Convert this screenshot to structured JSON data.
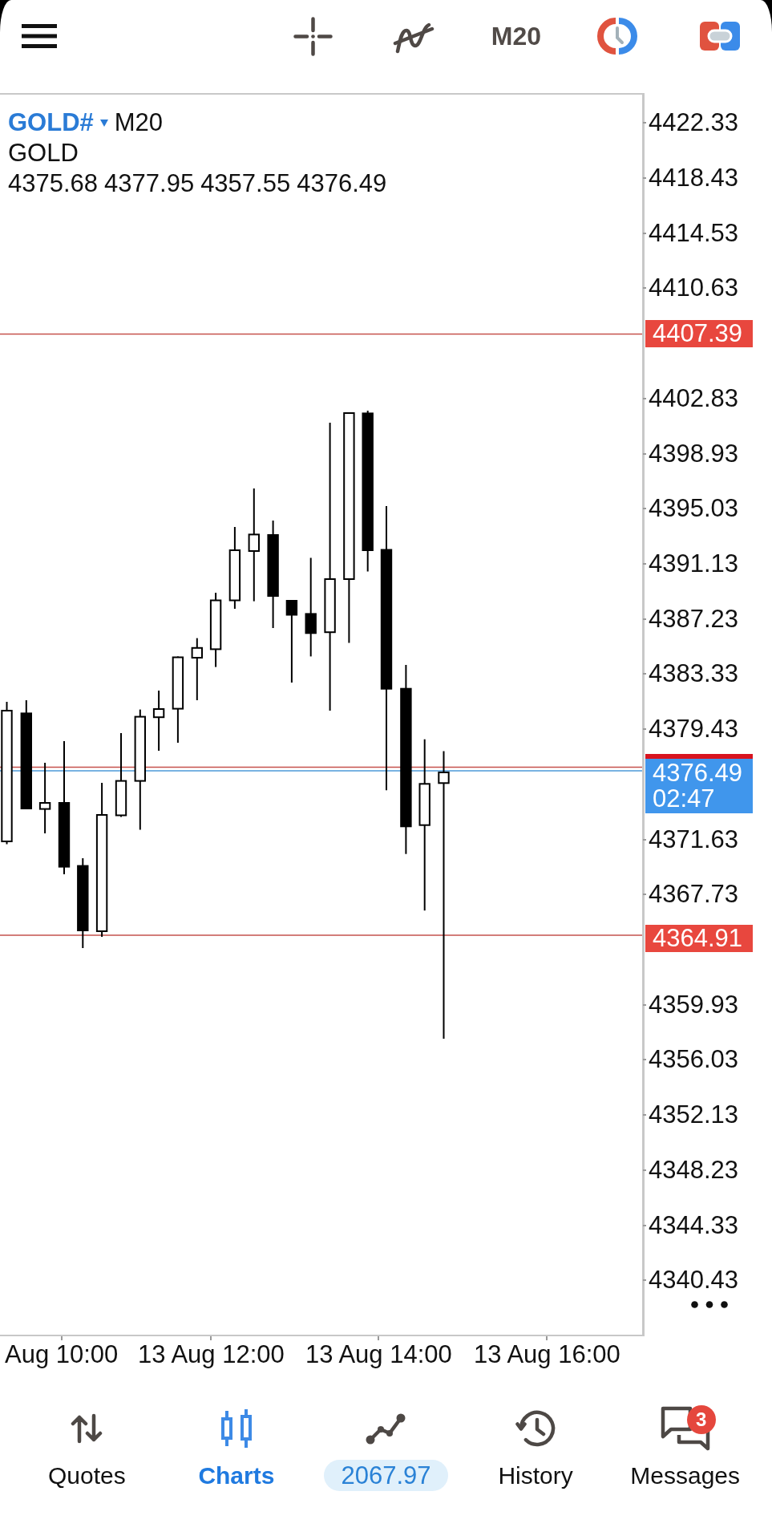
{
  "top_bar": {
    "timeframe": "M20"
  },
  "chart": {
    "symbol": "GOLD#",
    "timeframe": "M20",
    "description": "GOLD",
    "ohlc": [
      "4375.68",
      "4377.95",
      "4357.55",
      "4376.49"
    ],
    "price_ticks": [
      "4422.33",
      "4418.43",
      "4414.53",
      "4410.63",
      "4402.83",
      "4398.93",
      "4395.03",
      "4391.13",
      "4387.23",
      "4383.33",
      "4379.43",
      "4371.63",
      "4367.73",
      "4359.93",
      "4356.03",
      "4352.13",
      "4348.23",
      "4344.33",
      "4340.43"
    ],
    "price_tags": [
      {
        "kind": "level",
        "price": "4407.39"
      },
      {
        "kind": "bid",
        "price": "4376.49",
        "countdown": "02:47"
      },
      {
        "kind": "level",
        "price": "4364.91"
      }
    ],
    "time_labels": [
      "Aug 10:00",
      "13 Aug 12:00",
      "13 Aug 14:00",
      "13 Aug 16:00"
    ]
  },
  "bottom_nav": [
    {
      "label": "Quotes",
      "kind": "tab",
      "selected": false
    },
    {
      "label": "Charts",
      "kind": "tab",
      "selected": true
    },
    {
      "label": "2067.97",
      "kind": "balance",
      "selected": false
    },
    {
      "label": "History",
      "kind": "tab",
      "selected": false
    },
    {
      "label": "Messages",
      "kind": "tab",
      "selected": false,
      "badge": "3"
    }
  ]
}
